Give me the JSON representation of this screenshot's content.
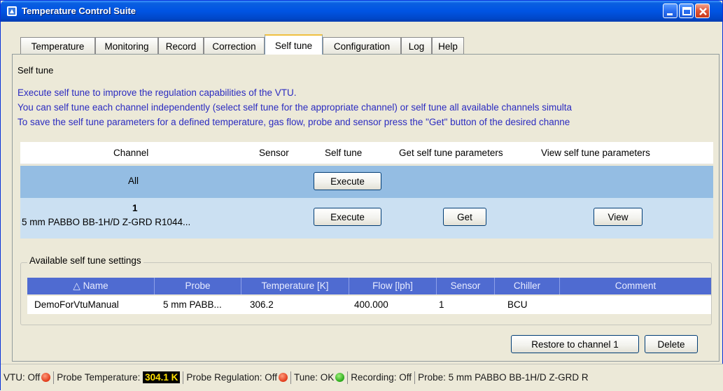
{
  "window": {
    "title": "Temperature Control Suite"
  },
  "tabs": [
    {
      "label": "Temperature"
    },
    {
      "label": "Monitoring"
    },
    {
      "label": "Record"
    },
    {
      "label": "Correction"
    },
    {
      "label": "Self tune",
      "active": true
    },
    {
      "label": "Configuration"
    },
    {
      "label": "Log"
    },
    {
      "label": "Help"
    }
  ],
  "self_tune": {
    "group_title": "Self tune",
    "info_lines": [
      "Execute self tune to improve the regulation capabilities of the VTU.",
      "You can self tune each channel independently (select self tune for the appropriate channel) or self tune all available channels simulta",
      "To save the self tune parameters for a defined temperature, gas flow, probe and sensor press the \"Get\" button of the desired channe"
    ],
    "channel_table": {
      "headers": {
        "channel": "Channel",
        "sensor": "Sensor",
        "self_tune": "Self tune",
        "get": "Get self tune parameters",
        "view": "View self tune parameters"
      },
      "row_all": {
        "channel": "All",
        "execute": "Execute"
      },
      "row_1": {
        "number": "1",
        "probe": "5 mm PABBO BB-1H/D Z-GRD R1044...",
        "execute": "Execute",
        "get": "Get",
        "view": "View"
      }
    }
  },
  "available": {
    "title": "Available self tune settings",
    "columns": [
      "Name",
      "Probe",
      "Temperature [K]",
      "Flow [lph]",
      "Sensor",
      "Chiller",
      "Comment"
    ],
    "sort_indicator": "△",
    "rows": [
      {
        "name": "DemoForVtuManual",
        "probe": "5 mm PABB...",
        "temperature": "306.2",
        "flow": "400.000",
        "sensor": "1",
        "chiller": "BCU",
        "comment": ""
      }
    ],
    "restore_label": "Restore to channel 1",
    "delete_label": "Delete"
  },
  "status": {
    "vtu": "VTU: Off",
    "probe_temp_label": "Probe Temperature: ",
    "probe_temp_value": "304.1 K",
    "probe_regulation": "Probe Regulation: Off",
    "tune": "Tune: OK",
    "recording": "Recording: Off",
    "probe": "Probe: 5 mm PABBO BB-1H/D Z-GRD R"
  },
  "colors": {
    "titlebar": "#0054e3",
    "info_text": "#2b2bc0",
    "row_all_bg": "#94bde3",
    "row_1_bg": "#cbe0f2",
    "grid_header_bg": "#4f6bd1",
    "temp_badge_bg": "#000000",
    "temp_badge_fg": "#ffe000"
  }
}
